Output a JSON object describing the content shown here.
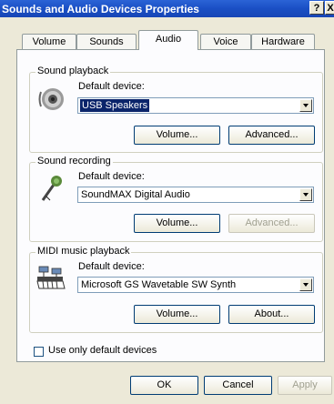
{
  "window": {
    "title": "Sounds and Audio Devices Properties",
    "help_glyph": "?",
    "close_glyph": "X"
  },
  "tabs": [
    {
      "label": "Volume"
    },
    {
      "label": "Sounds"
    },
    {
      "label": "Audio",
      "active": true
    },
    {
      "label": "Voice"
    },
    {
      "label": "Hardware"
    }
  ],
  "sound_playback": {
    "group_label": "Sound playback",
    "default_device_label": "Default device:",
    "selected_device": "USB Speakers",
    "volume_button": "Volume...",
    "advanced_button": "Advanced..."
  },
  "sound_recording": {
    "group_label": "Sound recording",
    "default_device_label": "Default device:",
    "selected_device": "SoundMAX Digital Audio",
    "volume_button": "Volume...",
    "advanced_button": "Advanced..."
  },
  "midi_playback": {
    "group_label": "MIDI music playback",
    "default_device_label": "Default device:",
    "selected_device": "Microsoft GS Wavetable SW Synth",
    "volume_button": "Volume...",
    "about_button": "About..."
  },
  "use_only_default_devices": {
    "label": "Use only default devices",
    "checked": false
  },
  "footer": {
    "ok_button": "OK",
    "cancel_button": "Cancel",
    "apply_button": "Apply"
  },
  "colors": {
    "title_bar": "#1a4fc4",
    "selection": "#0a246a",
    "dialog_bg": "#ece9d8"
  }
}
